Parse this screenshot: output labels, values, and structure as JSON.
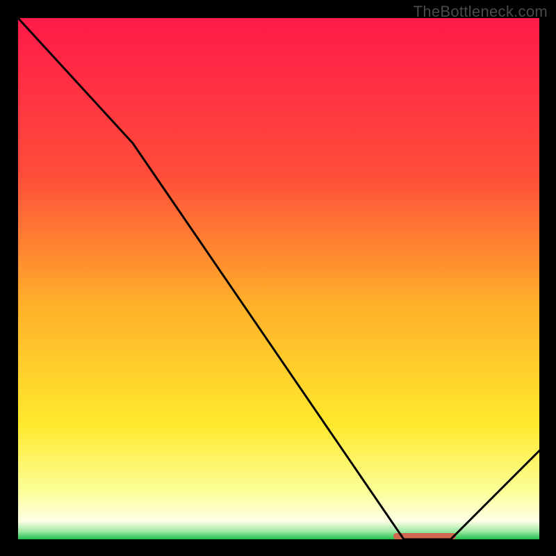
{
  "watermark": {
    "text": "TheBottleneck.com"
  },
  "chart_data": {
    "type": "line",
    "title": "",
    "xlabel": "",
    "ylabel": "",
    "xlim": [
      0,
      100
    ],
    "ylim": [
      0,
      100
    ],
    "grid": false,
    "legend": false,
    "series": [
      {
        "name": "curve",
        "x": [
          0,
          22,
          74,
          83,
          100
        ],
        "y": [
          100,
          76,
          0,
          0,
          17
        ],
        "color": "#000000"
      }
    ],
    "marker": {
      "name": "highlight-band",
      "x_start": 72,
      "x_end": 84,
      "y": 0,
      "color": "#cf684f"
    },
    "background_gradient": {
      "stops": [
        {
          "offset": 0.0,
          "color": "#ff1a4a"
        },
        {
          "offset": 0.3,
          "color": "#ff4d3a"
        },
        {
          "offset": 0.55,
          "color": "#ffb02a"
        },
        {
          "offset": 0.78,
          "color": "#ffe92d"
        },
        {
          "offset": 0.91,
          "color": "#fcff9a"
        },
        {
          "offset": 0.965,
          "color": "#ffffe6"
        },
        {
          "offset": 0.985,
          "color": "#9be8a2"
        },
        {
          "offset": 1.0,
          "color": "#1fbf4e"
        }
      ]
    }
  }
}
